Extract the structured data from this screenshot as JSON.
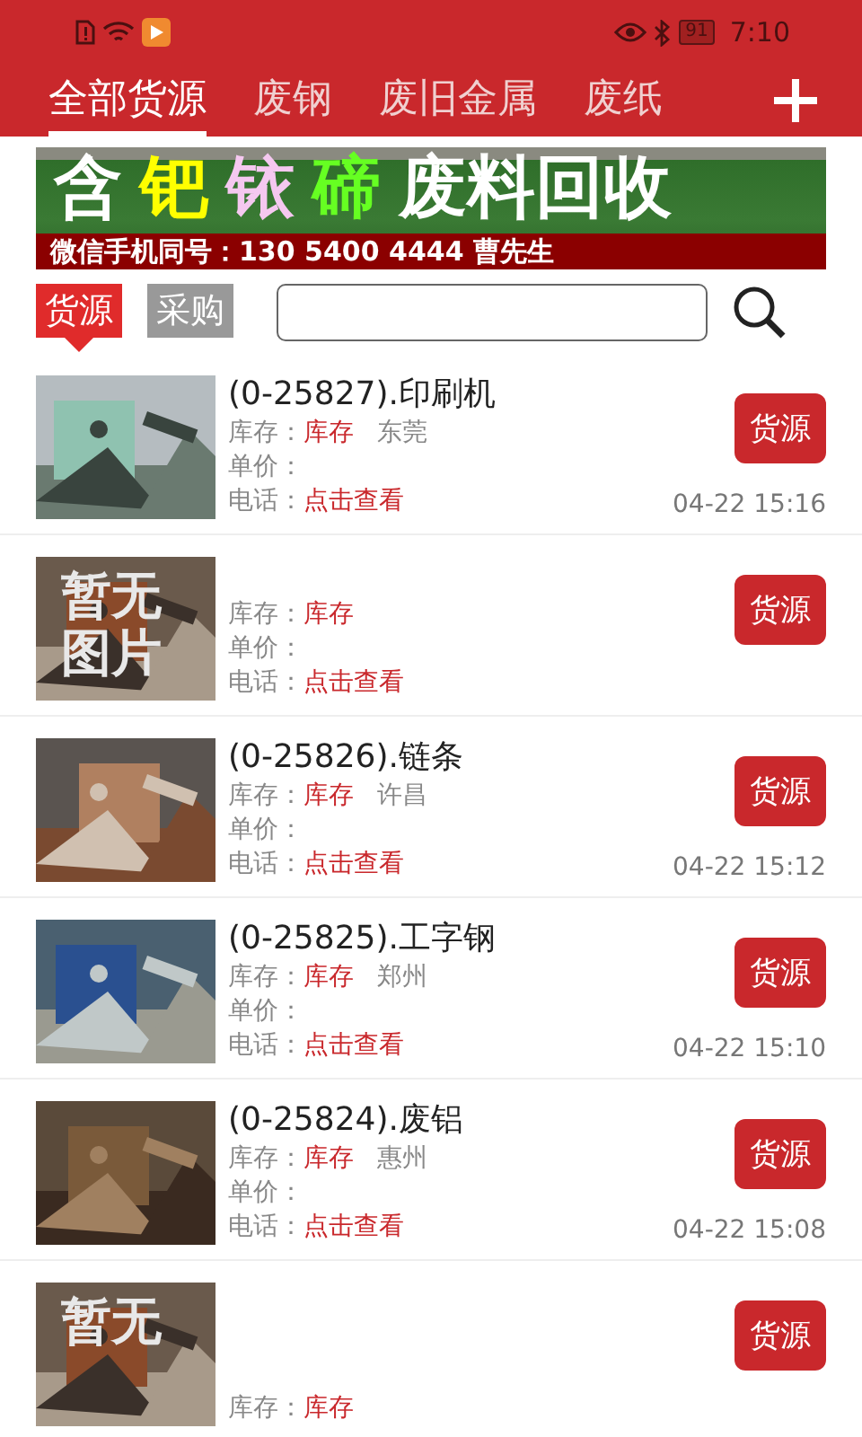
{
  "status_bar": {
    "battery": "91",
    "time": "7:10"
  },
  "tabs": [
    {
      "label": "全部货源",
      "selected": true
    },
    {
      "label": "废钢",
      "selected": false
    },
    {
      "label": "废旧金属",
      "selected": false
    },
    {
      "label": "废纸",
      "selected": false
    }
  ],
  "banner": {
    "headline": [
      "含",
      "钯",
      "铱",
      "碲",
      "废料回收"
    ],
    "contact": "微信手机同号：130 5400 4444 曹先生"
  },
  "filter_tabs": [
    {
      "label": "货源",
      "selected": true
    },
    {
      "label": "采购",
      "selected": false
    }
  ],
  "listings": [
    {
      "title": "(0-25827).印刷机",
      "stock_label": "库存：",
      "stock": "库存",
      "location": "东莞",
      "price_label": "单价：",
      "phone_label": "电话：",
      "phone": "点击查看",
      "button": "货源",
      "time": "04-22 15:16"
    },
    {
      "thumb": {
        "kind": "placeholder",
        "lines": [
          "暂无",
          "图片"
        ]
      },
      "stock_label": "库存：",
      "stock": "库存",
      "price_label": "单价：",
      "phone_label": "电话：",
      "phone": "点击查看",
      "button": "货源"
    },
    {
      "title": "(0-25826).链条",
      "stock_label": "库存：",
      "stock": "库存",
      "location": "许昌",
      "price_label": "单价：",
      "phone_label": "电话：",
      "phone": "点击查看",
      "button": "货源",
      "time": "04-22 15:12"
    },
    {
      "title": "(0-25825).工字钢",
      "stock_label": "库存：",
      "stock": "库存",
      "location": "郑州",
      "price_label": "单价：",
      "phone_label": "电话：",
      "phone": "点击查看",
      "button": "货源",
      "time": "04-22 15:10"
    },
    {
      "title": "(0-25824).废铝",
      "stock_label": "库存：",
      "stock": "库存",
      "location": "惠州",
      "price_label": "单价：",
      "phone_label": "电话：",
      "phone": "点击查看",
      "button": "货源",
      "time": "04-22 15:08"
    },
    {
      "thumb": {
        "kind": "placeholder",
        "lines": [
          "暂无"
        ]
      },
      "stock_label": "库存：",
      "stock": "库存",
      "button": "货源"
    }
  ]
}
